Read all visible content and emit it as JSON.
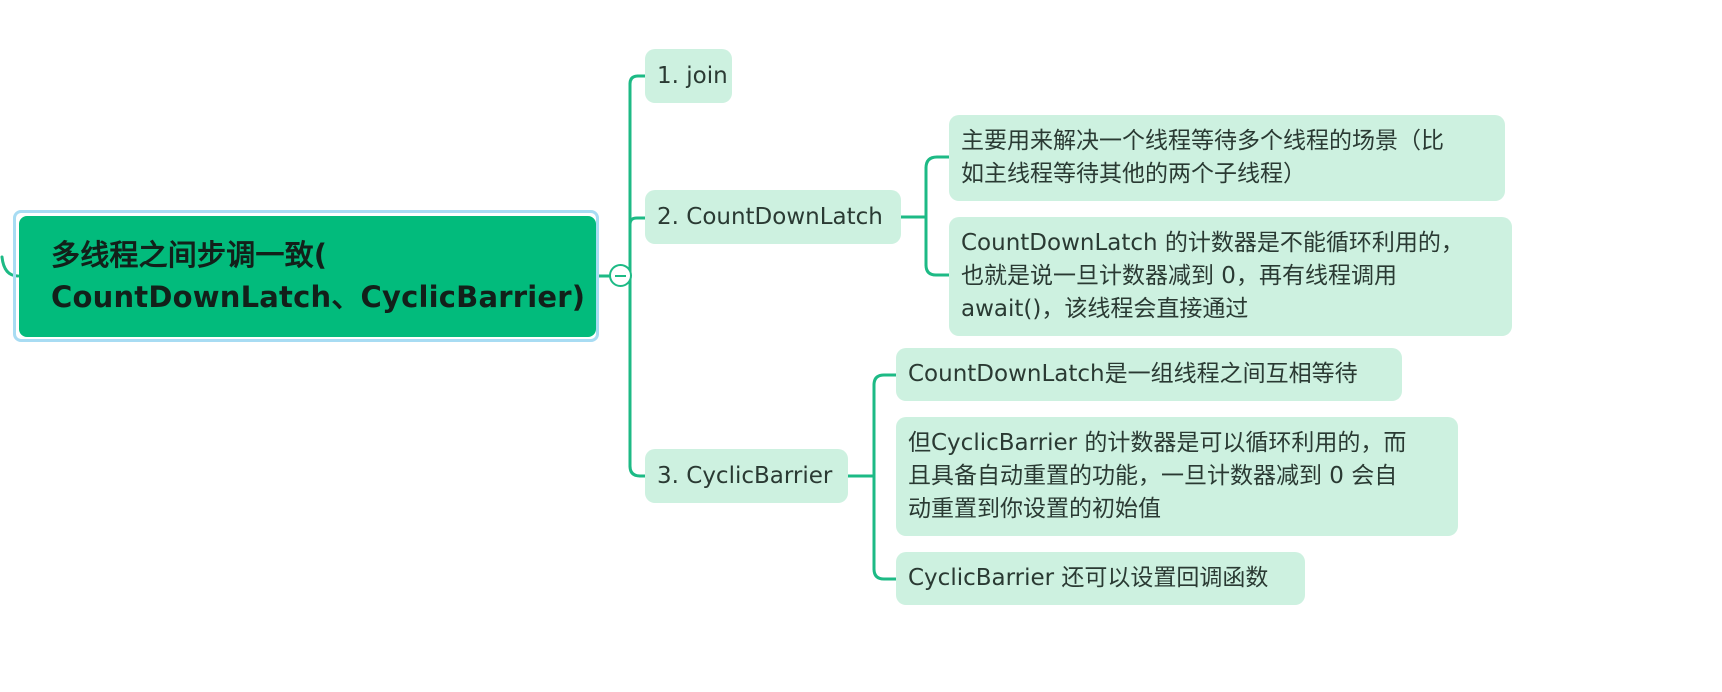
{
  "colors": {
    "root_fill": "#02bb7c",
    "root_selection_outline": "#a8dcf3",
    "node_fill": "#cdf1e0",
    "connector": "#1dba85"
  },
  "root": {
    "line1": "多线程之间步调一致(",
    "line2": "CountDownLatch、CyclicBarrier)",
    "collapse_icon": "minus-circle-icon"
  },
  "branches": [
    {
      "label": "1. join",
      "children": []
    },
    {
      "label": "2. CountDownLatch",
      "children": [
        {
          "lines": [
            "主要用来解决一个线程等待多个线程的场景（比",
            "如主线程等待其他的两个子线程）"
          ]
        },
        {
          "lines": [
            "CountDownLatch 的计数器是不能循环利用的，",
            "也就是说一旦计数器减到 0，再有线程调用",
            "await()，该线程会直接通过"
          ]
        }
      ]
    },
    {
      "label": "3. CyclicBarrier",
      "children": [
        {
          "lines": [
            "CountDownLatch是一组线程之间互相等待"
          ]
        },
        {
          "lines": [
            "但CyclicBarrier 的计数器是可以循环利用的，而",
            "且具备自动重置的功能，一旦计数器减到 0 会自",
            "动重置到你设置的初始值"
          ]
        },
        {
          "lines": [
            "CyclicBarrier 还可以设置回调函数"
          ]
        }
      ]
    }
  ]
}
